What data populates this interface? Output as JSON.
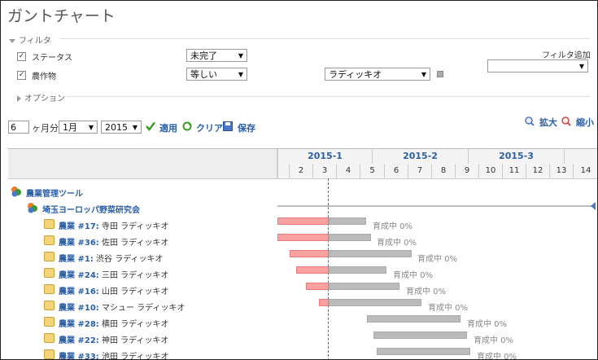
{
  "title": "ガントチャート",
  "filter": {
    "legend": "フィルタ",
    "rows": [
      {
        "label": "ステータス",
        "operator": "未完了"
      },
      {
        "label": "農作物",
        "operator": "等しい",
        "value": "ラディッキオ"
      }
    ],
    "add_label": "フィルタ追加",
    "add_value": ""
  },
  "options_legend": "オプション",
  "toolbar": {
    "months_value": "6",
    "months_suffix": "ヶ月分",
    "month_select": "1月",
    "year_select": "2015",
    "apply": "適用",
    "clear": "クリア",
    "save": "保存",
    "zoom_in": "拡大",
    "zoom_out": "縮小"
  },
  "gantt": {
    "months": [
      "2015-1",
      "2015-2",
      "2015-3"
    ],
    "days": [
      "2",
      "3",
      "4",
      "5",
      "6",
      "7",
      "8",
      "9",
      "10",
      "11",
      "12",
      "13",
      "14"
    ],
    "project": "農業管理ツール",
    "subproject": "埼玉ヨーロッパ野菜研究会",
    "issues": [
      {
        "id": "農業 #17:",
        "name": "寺田 ラディッキオ",
        "status": "育成中 0%"
      },
      {
        "id": "農業 #36:",
        "name": "佐田 ラディッキオ",
        "status": "育成中 0%"
      },
      {
        "id": "農業 #1:",
        "name": "渋谷 ラディッキオ",
        "status": "育成中 0%"
      },
      {
        "id": "農業 #24:",
        "name": "三田 ラディッキオ",
        "status": "育成中 0%"
      },
      {
        "id": "農業 #16:",
        "name": "山田 ラディッキオ",
        "status": "育成中 0%"
      },
      {
        "id": "農業 #10:",
        "name": "マシュー ラディッキオ",
        "status": "育成中 0%"
      },
      {
        "id": "農業 #28:",
        "name": "横田 ラディッキオ",
        "status": "育成中 0%"
      },
      {
        "id": "農業 #22:",
        "name": "神田 ラディッキオ",
        "status": "育成中 0%"
      },
      {
        "id": "農業 #33:",
        "name": "池田 ラディッキオ",
        "status": "育成中 0%"
      }
    ]
  }
}
